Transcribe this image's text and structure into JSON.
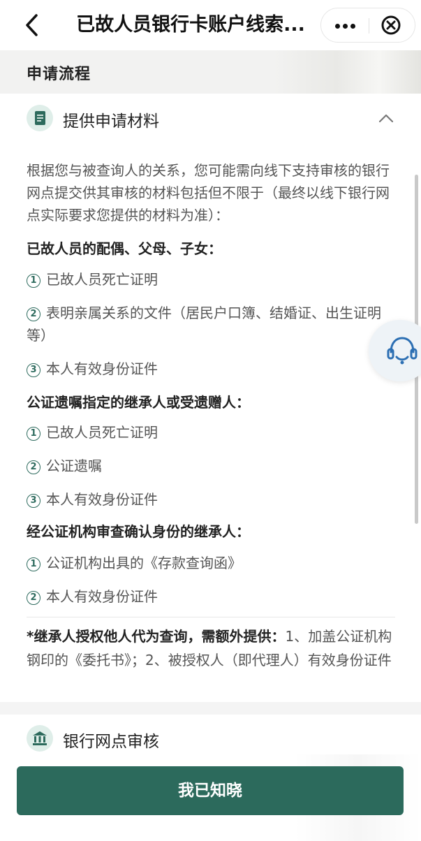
{
  "header": {
    "title": "已故人员银行卡账户线索...",
    "icons": {
      "back": "chevron-left-icon",
      "more": "more-dots-icon",
      "close": "close-circle-icon"
    }
  },
  "section": {
    "title": "申请流程"
  },
  "step1": {
    "title": "提供申请材料",
    "icon": "document-icon",
    "intro": "根据您与被查询人的关系，您可能需向线下支持审核的银行网点提交供其审核的材料包括但不限于（最终以线下银行网点实际要求您提供的材料为准）：",
    "groups": [
      {
        "heading": "已故人员的配偶、父母、子女：",
        "items": [
          {
            "num": "1",
            "text": "已故人员死亡证明"
          },
          {
            "num": "2",
            "text": "表明亲属关系的文件（居民户口簿、结婚证、出生证明等）"
          },
          {
            "num": "3",
            "text": "本人有效身份证件"
          }
        ]
      },
      {
        "heading": "公证遗嘱指定的继承人或受遗赠人：",
        "items": [
          {
            "num": "1",
            "text": "已故人员死亡证明"
          },
          {
            "num": "2",
            "text": "公证遗嘱"
          },
          {
            "num": "3",
            "text": "本人有效身份证件"
          }
        ]
      },
      {
        "heading": "经公证机构审查确认身份的继承人：",
        "items": [
          {
            "num": "1",
            "text": "公证机构出具的《存款查询函》"
          },
          {
            "num": "2",
            "text": "本人有效身份证件"
          }
        ]
      }
    ],
    "note_bold": "*继承人授权他人代为查询，需额外提供：",
    "note_rest": "1、加盖公证机构钢印的《委托书》；2、被授权人（即代理人）有效身份证件"
  },
  "step2": {
    "title": "银行网点审核",
    "icon": "bank-icon"
  },
  "floating": {
    "icon": "headset-icon"
  },
  "bottom": {
    "confirm_label": "我已知晓"
  },
  "colors": {
    "accent": "#2c6a5c",
    "icon_bg": "#dfeee9"
  }
}
